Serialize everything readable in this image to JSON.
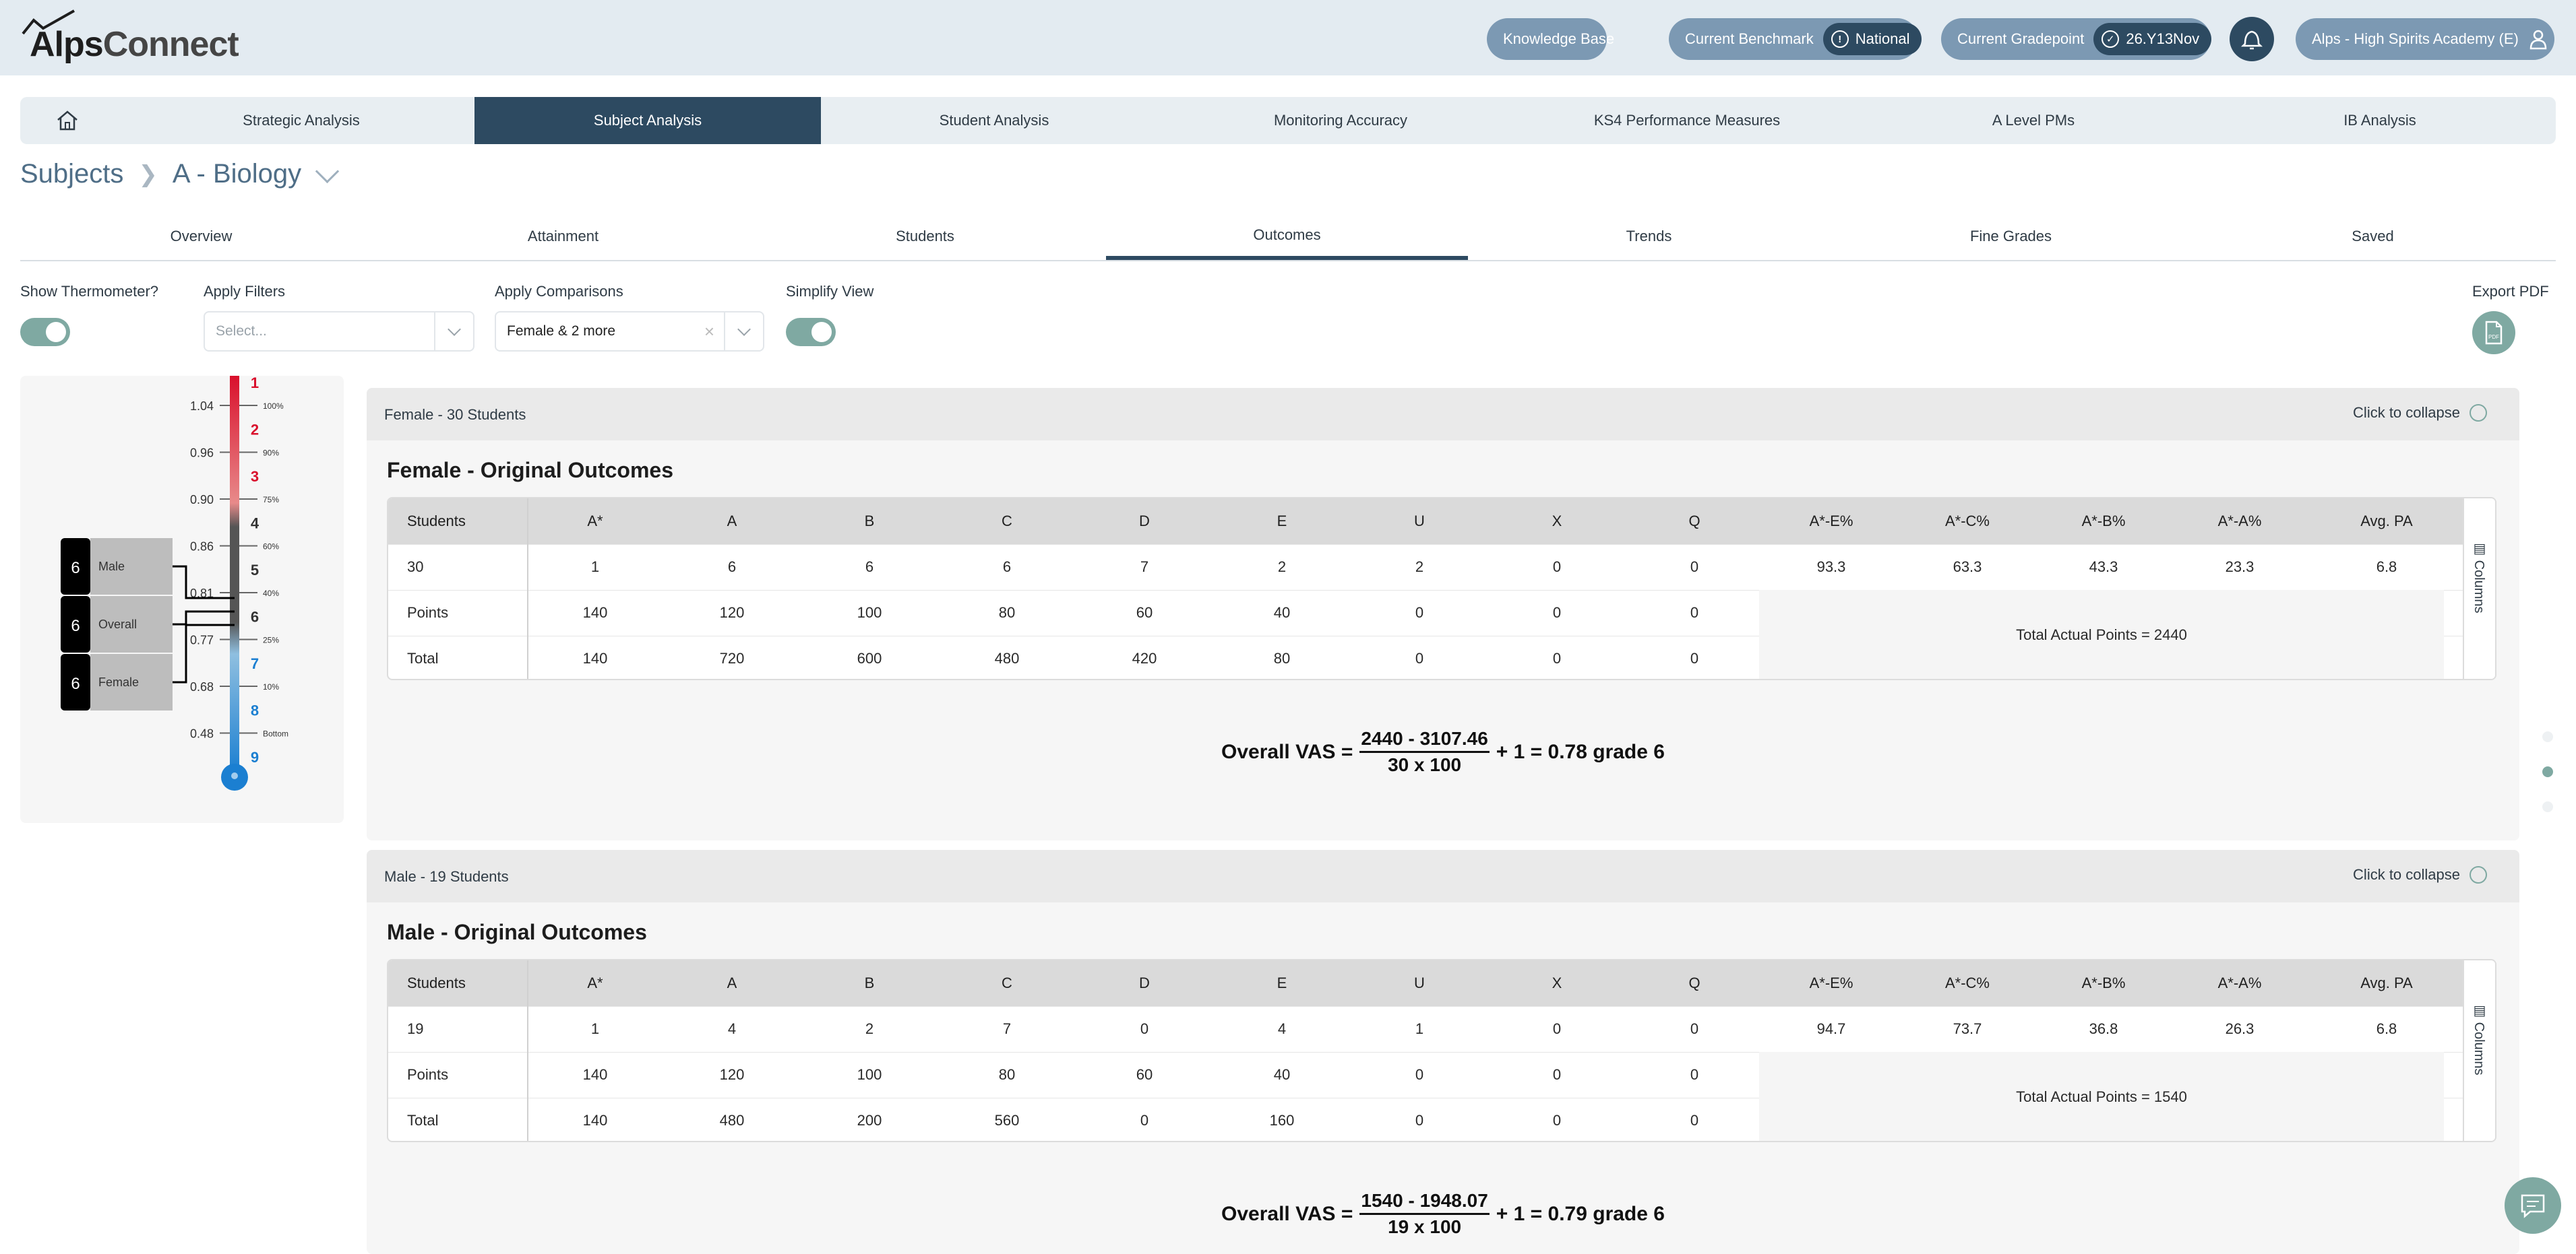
{
  "app": {
    "logo_alps": "Alps",
    "logo_connect": "Connect"
  },
  "topbar": {
    "knowledge_base": "Knowledge Base",
    "benchmark_label": "Current Benchmark",
    "benchmark_value": "National",
    "gradepoint_label": "Current Gradepoint",
    "gradepoint_value": "26.Y13Nov",
    "school": "Alps - High Spirits Academy (E)"
  },
  "nav": {
    "items": [
      "Strategic Analysis",
      "Subject Analysis",
      "Student Analysis",
      "Monitoring Accuracy",
      "KS4 Performance Measures",
      "A Level PMs",
      "IB Analysis"
    ],
    "active": "Subject Analysis"
  },
  "breadcrumb": {
    "root": "Subjects",
    "current": "A - Biology"
  },
  "subtabs": {
    "items": [
      "Overview",
      "Attainment",
      "Students",
      "Outcomes",
      "Trends",
      "Fine Grades",
      "Saved"
    ],
    "active": "Outcomes"
  },
  "controls": {
    "show_thermometer": "Show Thermometer?",
    "apply_filters": "Apply Filters",
    "filters_placeholder": "Select...",
    "apply_comparisons": "Apply Comparisons",
    "comparisons_value": "Female & 2 more",
    "simplify_view": "Simplify View",
    "export_pdf": "Export PDF"
  },
  "thermometer": {
    "scale": [
      {
        "value": "1.04",
        "grade": "1",
        "pct": "100%",
        "color": "#d9102c"
      },
      {
        "value": "0.96",
        "grade": "2",
        "pct": "90%",
        "color": "#d9102c"
      },
      {
        "value": "0.90",
        "grade": "3",
        "pct": "75%",
        "color": "#d9102c"
      },
      {
        "value": "0.86",
        "grade": "4",
        "pct": "60%",
        "color": "#333333"
      },
      {
        "value": "0.81",
        "grade": "5",
        "pct": "40%",
        "color": "#333333"
      },
      {
        "value": "0.77",
        "grade": "6",
        "pct": "25%",
        "color": "#333333"
      },
      {
        "value": "0.68",
        "grade": "7",
        "pct": "10%",
        "color": "#1b7fd1"
      },
      {
        "value": "0.48",
        "grade": "8",
        "pct": "Bottom",
        "color": "#1b7fd1"
      },
      {
        "value": "",
        "grade": "9",
        "pct": "",
        "color": "#1b7fd1"
      }
    ],
    "markers": [
      {
        "grade": "6",
        "label": "Male"
      },
      {
        "grade": "6",
        "label": "Overall"
      },
      {
        "grade": "6",
        "label": "Female"
      }
    ]
  },
  "columns_label": "Columns",
  "collapse_label": "Click to collapse",
  "table_headers": [
    "Students",
    "A*",
    "A",
    "B",
    "C",
    "D",
    "E",
    "U",
    "X",
    "Q",
    "A*-E%",
    "A*-C%",
    "A*-B%",
    "A*-A%",
    "Avg. PA"
  ],
  "panels": [
    {
      "header": "Female - 30 Students",
      "title": "Female - Original Outcomes",
      "row_students": [
        "30",
        "1",
        "6",
        "6",
        "6",
        "7",
        "2",
        "2",
        "0",
        "0",
        "93.3",
        "63.3",
        "43.3",
        "23.3",
        "6.8"
      ],
      "row_points": [
        "Points",
        "140",
        "120",
        "100",
        "80",
        "60",
        "40",
        "0",
        "0",
        "0"
      ],
      "row_total": [
        "Total",
        "140",
        "720",
        "600",
        "480",
        "420",
        "80",
        "0",
        "0",
        "0"
      ],
      "total_points": "Total Actual Points = 2440",
      "formula": {
        "prefix": "Overall VAS =",
        "numerator": "2440 - 3107.46",
        "denominator": "30 x 100",
        "suffix": "+ 1 = 0.78 grade 6"
      }
    },
    {
      "header": "Male - 19 Students",
      "title": "Male - Original Outcomes",
      "row_students": [
        "19",
        "1",
        "4",
        "2",
        "7",
        "0",
        "4",
        "1",
        "0",
        "0",
        "94.7",
        "73.7",
        "36.8",
        "26.3",
        "6.8"
      ],
      "row_points": [
        "Points",
        "140",
        "120",
        "100",
        "80",
        "60",
        "40",
        "0",
        "0",
        "0"
      ],
      "row_total": [
        "Total",
        "140",
        "480",
        "200",
        "560",
        "0",
        "160",
        "0",
        "0",
        "0"
      ],
      "total_points": "Total Actual Points = 1540",
      "formula": {
        "prefix": "Overall VAS =",
        "numerator": "1540 - 1948.07",
        "denominator": "19 x 100",
        "suffix": "+ 1 = 0.79 grade 6"
      }
    }
  ]
}
